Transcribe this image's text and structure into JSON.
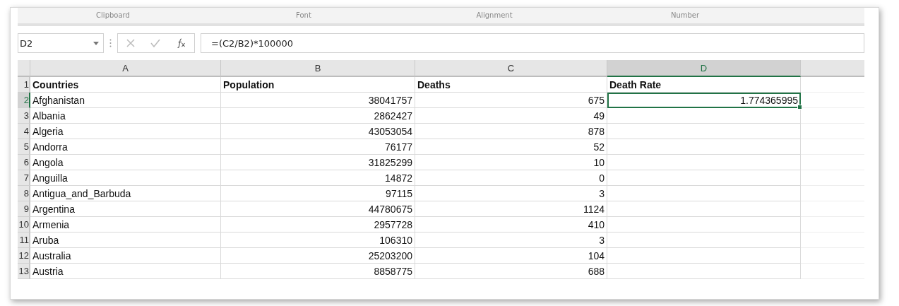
{
  "ribbon_groups": [
    {
      "label": "Clipboard"
    },
    {
      "label": "Font"
    },
    {
      "label": "Alignment"
    },
    {
      "label": "Number"
    }
  ],
  "name_box": {
    "value": "D2"
  },
  "formula_bar": {
    "value": "=(C2/B2)*100000"
  },
  "columns": [
    {
      "label": "A",
      "kind": "text",
      "selected": false
    },
    {
      "label": "B",
      "kind": "number",
      "selected": false
    },
    {
      "label": "C",
      "kind": "number",
      "selected": false
    },
    {
      "label": "D",
      "kind": "number",
      "selected": true
    }
  ],
  "rows": [
    {
      "number": "1",
      "kind": "header",
      "selected": false,
      "cells": [
        "Countries",
        "Population",
        "Deaths",
        "Death Rate"
      ]
    },
    {
      "number": "2",
      "kind": "data",
      "selected": true,
      "cells": [
        "Afghanistan",
        "38041757",
        "675",
        "1.774365995"
      ]
    },
    {
      "number": "3",
      "kind": "data",
      "selected": false,
      "cells": [
        "Albania",
        "2862427",
        "49"
      ]
    },
    {
      "number": "4",
      "kind": "data",
      "selected": false,
      "cells": [
        "Algeria",
        "43053054",
        "878"
      ]
    },
    {
      "number": "5",
      "kind": "data",
      "selected": false,
      "cells": [
        "Andorra",
        "76177",
        "52"
      ]
    },
    {
      "number": "6",
      "kind": "data",
      "selected": false,
      "cells": [
        "Angola",
        "31825299",
        "10"
      ]
    },
    {
      "number": "7",
      "kind": "data",
      "selected": false,
      "cells": [
        "Anguilla",
        "14872",
        "0"
      ]
    },
    {
      "number": "8",
      "kind": "data",
      "selected": false,
      "cells": [
        "Antigua_and_Barbuda",
        "97115",
        "3"
      ]
    },
    {
      "number": "9",
      "kind": "data",
      "selected": false,
      "cells": [
        "Argentina",
        "44780675",
        "1124"
      ]
    },
    {
      "number": "10",
      "kind": "data",
      "selected": false,
      "cells": [
        "Armenia",
        "2957728",
        "410"
      ]
    },
    {
      "number": "11",
      "kind": "data",
      "selected": false,
      "cells": [
        "Aruba",
        "106310",
        "3"
      ]
    },
    {
      "number": "12",
      "kind": "data",
      "selected": false,
      "cells": [
        "Australia",
        "25203200",
        "104"
      ]
    },
    {
      "number": "13",
      "kind": "data",
      "selected": false,
      "cells": [
        "Austria",
        "8858775",
        "688"
      ]
    }
  ]
}
